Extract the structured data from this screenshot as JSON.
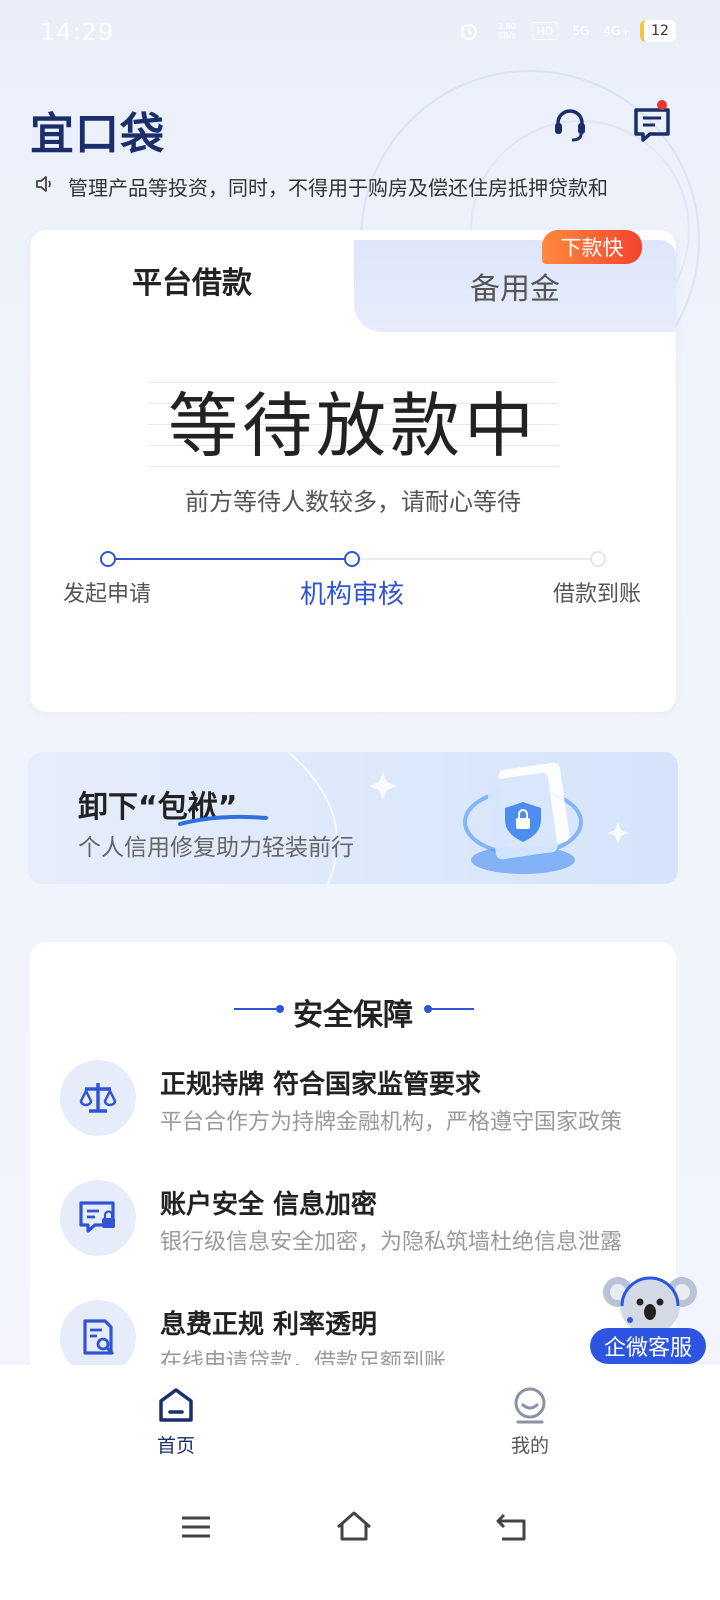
{
  "status_bar": {
    "time": "14:29",
    "net_speed": "2.80 KB/s",
    "hd": "HD",
    "sim1": "5G",
    "sim2": "4G+",
    "battery": "12"
  },
  "header": {
    "logo": "宜口袋",
    "support_icon": "headset-icon",
    "message_icon": "message-icon"
  },
  "marquee": {
    "text": "管理产品等投资，同时，不得用于购房及偿还住房抵押贷款和"
  },
  "loan_card": {
    "tabs": [
      {
        "label": "平台借款",
        "active": true
      },
      {
        "label": "备用金",
        "active": false
      }
    ],
    "badge": "下款快",
    "status_title": "等待放款中",
    "status_sub": "前方等待人数较多，请耐心等待",
    "steps": [
      {
        "label": "发起申请",
        "done": true
      },
      {
        "label": "机构审核",
        "done": true,
        "current": true
      },
      {
        "label": "借款到账",
        "done": false
      }
    ],
    "accent": "#2f55d4"
  },
  "banner": {
    "title": "卸下“包袱”",
    "subtitle": "个人信用修复助力轻装前行"
  },
  "safety": {
    "title": "安全保障",
    "items": [
      {
        "icon": "scale-icon",
        "title": "正规持牌 符合国家监管要求",
        "desc": "平台合作方为持牌金融机构，严格遵守国家政策"
      },
      {
        "icon": "chat-lock-icon",
        "title": "账户安全 信息加密",
        "desc": "银行级信息安全加密，为隐私筑墙杜绝信息泄露"
      },
      {
        "icon": "doc-search-icon",
        "title": "息费正规  利率透明",
        "desc": "在线申请贷款，借款足额到账"
      }
    ]
  },
  "cs_float": {
    "label": "企微客服"
  },
  "bottom_nav": {
    "items": [
      {
        "label": "首页",
        "icon": "home-icon",
        "active": true
      },
      {
        "label": "我的",
        "icon": "profile-icon",
        "active": false
      }
    ]
  },
  "system_nav": {
    "menu": "menu-icon",
    "home": "home-outline-icon",
    "back": "back-icon"
  }
}
